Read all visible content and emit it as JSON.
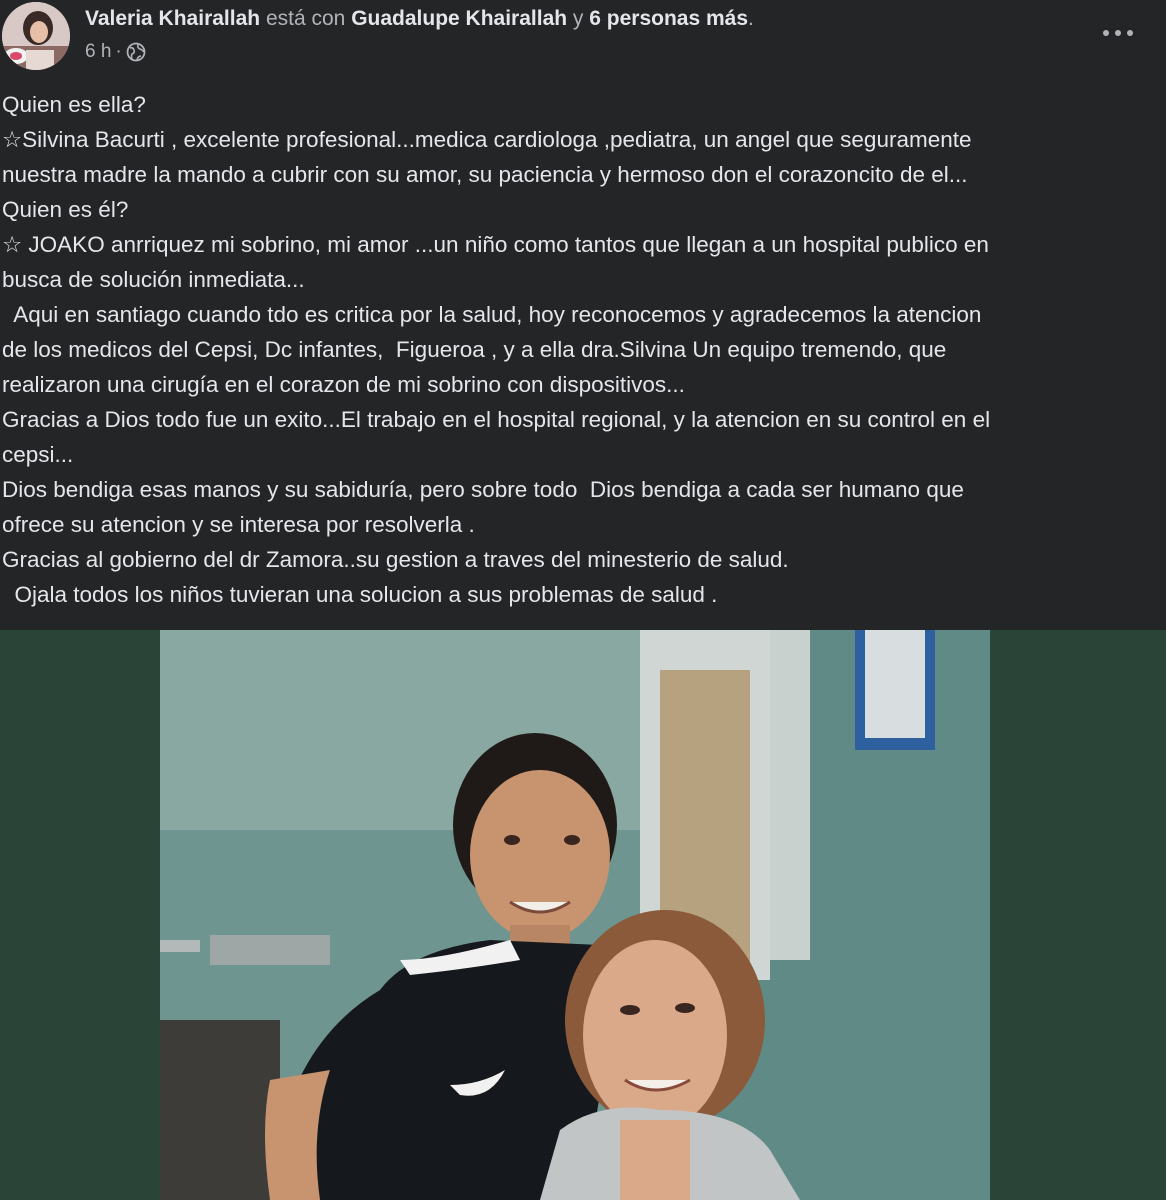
{
  "post": {
    "author": "Valeria Khairallah",
    "with_text": "está con",
    "tagged_person": "Guadalupe Khairallah",
    "conjunction": "y",
    "others": "6 personas más",
    "period": ".",
    "time": "6 h",
    "separator": "·",
    "privacy_icon": "globe-icon",
    "more_icon": "more-dots-icon",
    "more_label": "•••",
    "text_lines": [
      "Quien es ella?",
      "☆Silvina Bacurti , excelente profesional...medica cardiologa ,pediatra, un angel que seguramente",
      "nuestra madre la mando a cubrir con su amor, su paciencia y hermoso don el corazoncito de el...",
      "Quien es él?",
      "☆ JOAKO anrriquez mi sobrino, mi amor ...un niño como tantos que llegan a un hospital publico en",
      "busca de solución inmediata...",
      "  Aqui en santiago cuando tdo es critica por la salud, hoy reconocemos y agradecemos la atencion",
      "de los medicos del Cepsi, Dc infantes,  Figueroa , y a ella dra.Silvina Un equipo tremendo, que",
      "realizaron una cirugía en el corazon de mi sobrino con dispositivos...",
      "Gracias a Dios todo fue un exito...El trabajo en el hospital regional, y la atencion en su control en el",
      "cepsi...",
      "Dios bendiga esas manos y su sabiduría, pero sobre todo  Dios bendiga a cada ser humano que",
      "ofrece su atencion y se interesa por resolverla .",
      "Gracias al gobierno del dr Zamora..su gestion a traves del minesterio de salud.",
      "  Ojala todos los niños tuvieran una solucion a sus problemas de salud ."
    ]
  },
  "colors": {
    "background": "#242526",
    "text_primary": "#e4e6eb",
    "text_secondary": "#b0b3b8",
    "photo_backdrop": "#2a4538"
  }
}
